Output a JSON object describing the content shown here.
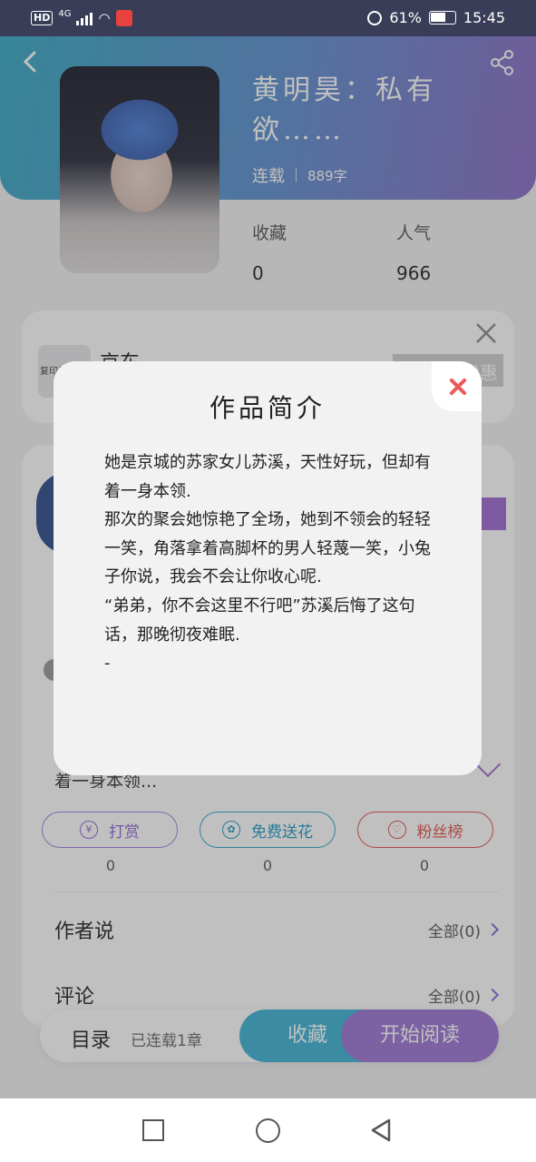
{
  "status_bar": {
    "hd": "HD",
    "network": "4G",
    "battery_pct": "61%",
    "time": "15:45"
  },
  "book": {
    "title": "黄明昊：私有欲……",
    "status": "连载",
    "words": "889字",
    "fav_label": "收藏",
    "fav_value": "0",
    "pop_label": "人气",
    "pop_value": "966"
  },
  "ad": {
    "thumb_text": "复印纸",
    "name": "京东",
    "button_tail": "优惠"
  },
  "intro_preview": "着一身本领...",
  "actions": {
    "tip_label": "打赏",
    "tip_count": "0",
    "flower_label": "免费送花",
    "flower_count": "0",
    "fans_label": "粉丝榜",
    "fans_count": "0"
  },
  "rows": {
    "author_says": "作者说",
    "author_says_right": "全部(0)",
    "comments": "评论",
    "comments_right": "全部(0)"
  },
  "bottom_bar": {
    "toc": "目录",
    "chapter_count": "已连载1章",
    "collect": "收藏",
    "read": "开始阅读"
  },
  "modal": {
    "title": "作品简介",
    "paragraphs": [
      "她是京城的苏家女儿苏溪，天性好玩，但却有着一身本领.",
      "那次的聚会她惊艳了全场，她到不领会的轻轻一笑，角落拿着高脚杯的男人轻蔑一笑，小兔子你说，我会不会让你收心呢.",
      "“弟弟，你不会这里不行吧”苏溪后悔了这句话，那晚彻夜难眠.",
      "-"
    ]
  },
  "colors": {
    "accent_purple": "#9b74d4",
    "accent_teal": "#3bb3d3",
    "close_red": "#ea5a5a"
  }
}
